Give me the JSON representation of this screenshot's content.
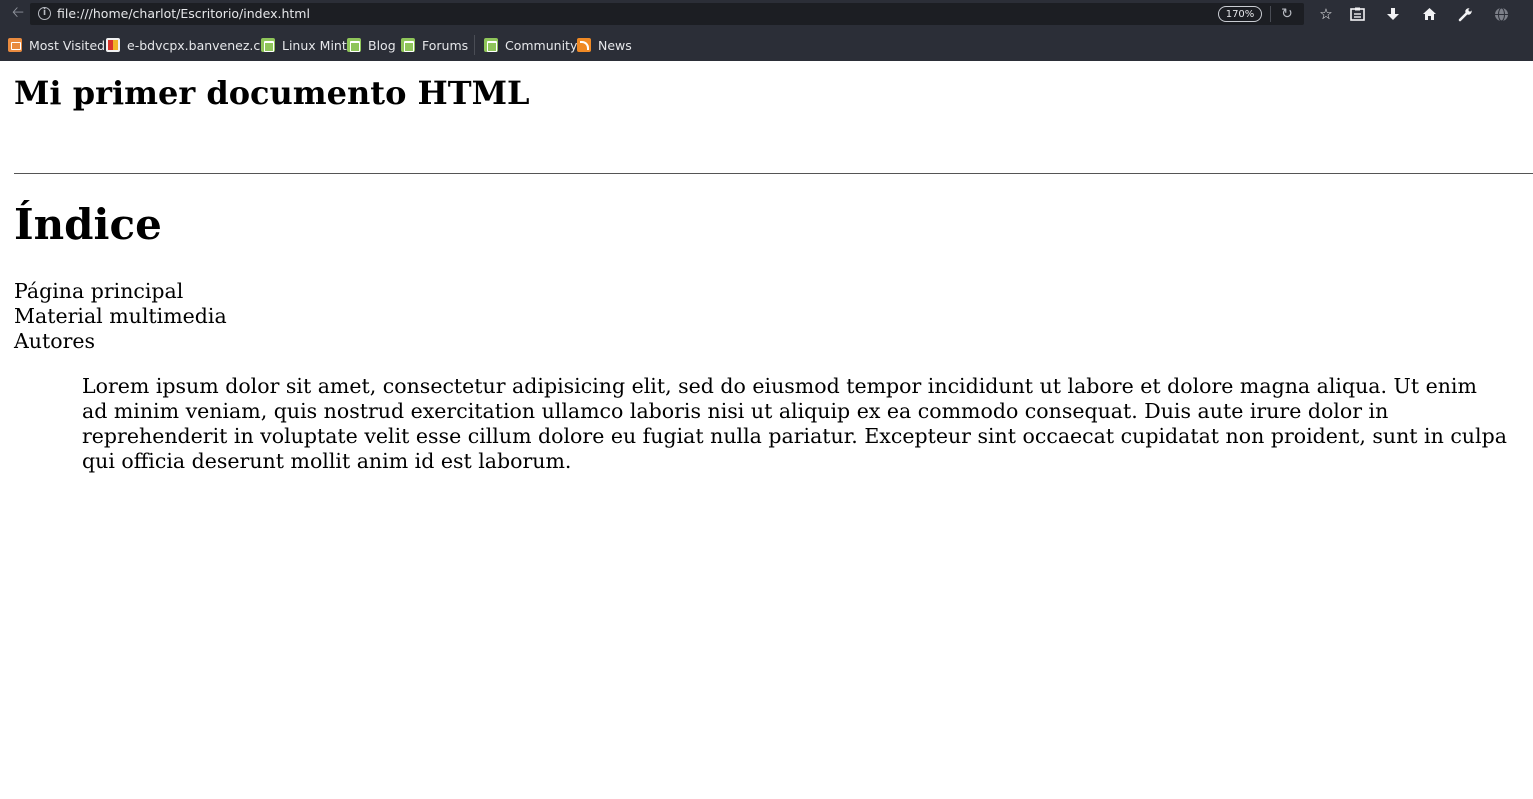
{
  "browser": {
    "url": "file:///home/charlot/Escritorio/index.html",
    "zoom": "170%",
    "icons": {
      "back": "back-arrow-icon",
      "info": "info-icon",
      "reload": "reload-icon",
      "toolbar": [
        "star-icon",
        "reading-list-icon",
        "download-icon",
        "home-icon",
        "wrench-icon",
        "globe-icon"
      ]
    }
  },
  "bookmarks": [
    {
      "label": "Most Visited",
      "icon": "folder-icon"
    },
    {
      "label": "e-bdvcpx.banvenez.c...",
      "icon": "bank-favicon-icon"
    },
    {
      "label": "Linux Mint",
      "icon": "linux-mint-icon"
    },
    {
      "label": "Blog",
      "icon": "linux-mint-icon"
    },
    {
      "label": "Forums",
      "icon": "linux-mint-icon"
    },
    {
      "label": "Community",
      "icon": "linux-mint-icon"
    },
    {
      "label": "News",
      "icon": "rss-icon"
    }
  ],
  "document": {
    "heading": "Mi primer documento HTML",
    "index_title": "Índice",
    "nav_items": [
      "Página principal",
      "Material multimedia",
      "Autores"
    ],
    "paragraph": "Lorem ipsum dolor sit amet, consectetur adipisicing elit, sed do eiusmod tempor incididunt ut labore et dolore magna aliqua. Ut enim ad minim veniam, quis nostrud exercitation ullamco laboris nisi ut aliquip ex ea commodo consequat. Duis aute irure dolor in reprehenderit in voluptate velit esse cillum dolore eu fugiat nulla pariatur. Excepteur sint occaecat cupidatat non proident, sunt in culpa qui officia deserunt mollit anim id est laborum."
  }
}
